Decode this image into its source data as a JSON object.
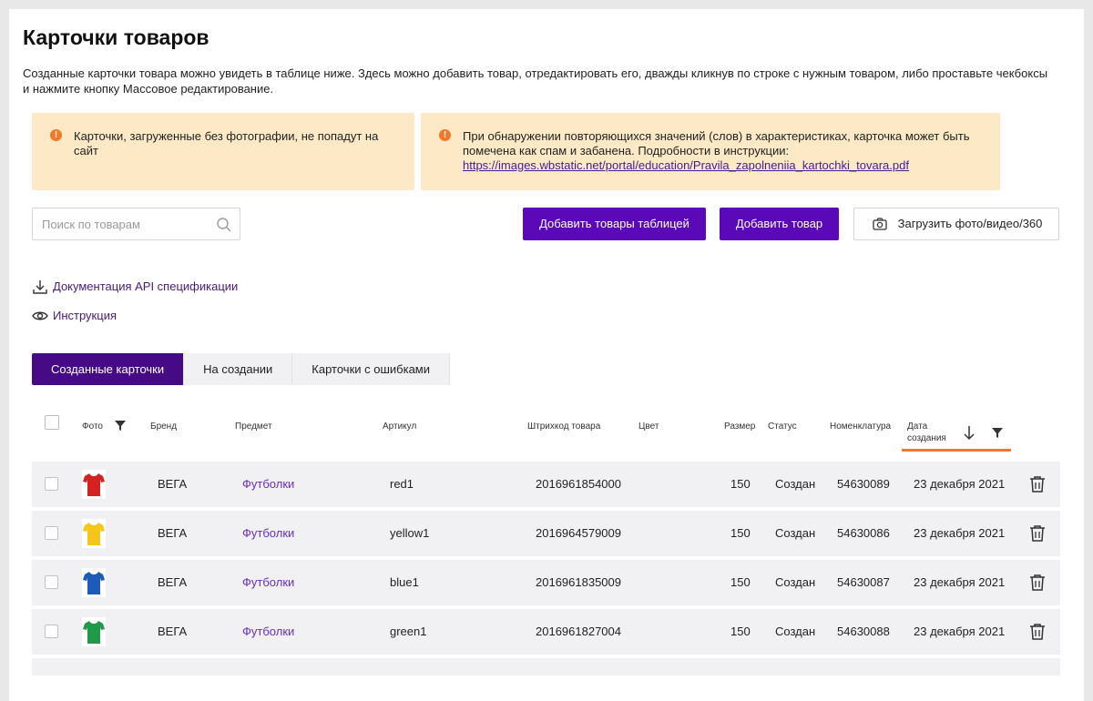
{
  "page": {
    "title": "Карточки товаров",
    "description": "Созданные карточки товара можно увидеть в таблице ниже. Здесь можно добавить товар, отредактировать его, дважды кликнув по строке с нужным товаром, либо проставьте чекбоксы и нажмите кнопку Массовое редактирование."
  },
  "notices": {
    "photo": {
      "text": "Карточки, загруженные без фотографии, не попадут на сайт"
    },
    "spam": {
      "text": "При обнаружении повторяющихся значений (слов) в характеристиках, карточка может быть помечена как спам и забанена. Подробности в инструкции:",
      "link": "https://images.wbstatic.net/portal/education/Pravila_zapolneniia_kartochki_tovara.pdf"
    }
  },
  "search": {
    "placeholder": "Поиск по товарам",
    "icon": "search-icon"
  },
  "actions": {
    "add_table": "Добавить товары таблицей",
    "add_product": "Добавить товар",
    "upload_media": "Загрузить фото/видео/360"
  },
  "links": {
    "api_docs": "Документация API спецификации",
    "instruction": "Инструкция"
  },
  "tabs": [
    "Созданные карточки",
    "На создании",
    "Карточки с ошибками"
  ],
  "table": {
    "headers": {
      "photo": "Фото",
      "brand": "Бренд",
      "subject": "Предмет",
      "article": "Артикул",
      "barcode": "Штрихкод товара",
      "color": "Цвет",
      "size": "Размер",
      "status": "Статус",
      "nomenclature": "Номенклатура",
      "date_line1": "Дата",
      "date_line2": "создания"
    },
    "rows": [
      {
        "color_hex": "#d42121",
        "brand": "ВЕГА",
        "subject": "Футболки",
        "article": "red1",
        "barcode": "2016961854000",
        "size": "150",
        "status": "Создан",
        "nomenclature": "54630089",
        "date": "23 декабря 2021"
      },
      {
        "color_hex": "#f5c518",
        "brand": "ВЕГА",
        "subject": "Футболки",
        "article": "yellow1",
        "barcode": "2016964579009",
        "size": "150",
        "status": "Создан",
        "nomenclature": "54630086",
        "date": "23 декабря 2021"
      },
      {
        "color_hex": "#1c5bb8",
        "brand": "ВЕГА",
        "subject": "Футболки",
        "article": "blue1",
        "barcode": "2016961835009",
        "size": "150",
        "status": "Создан",
        "nomenclature": "54630087",
        "date": "23 декабря 2021"
      },
      {
        "color_hex": "#1f9a48",
        "brand": "ВЕГА",
        "subject": "Футболки",
        "article": "green1",
        "barcode": "2016961827004",
        "size": "150",
        "status": "Создан",
        "nomenclature": "54630088",
        "date": "23 декабря 2021"
      }
    ]
  },
  "colors": {
    "accent": "#5b09b8",
    "tab_active": "#470a87",
    "notice_bg": "#fde9c5",
    "notice_icon": "#f07a2a",
    "sort_underline": "#f07a2a"
  }
}
